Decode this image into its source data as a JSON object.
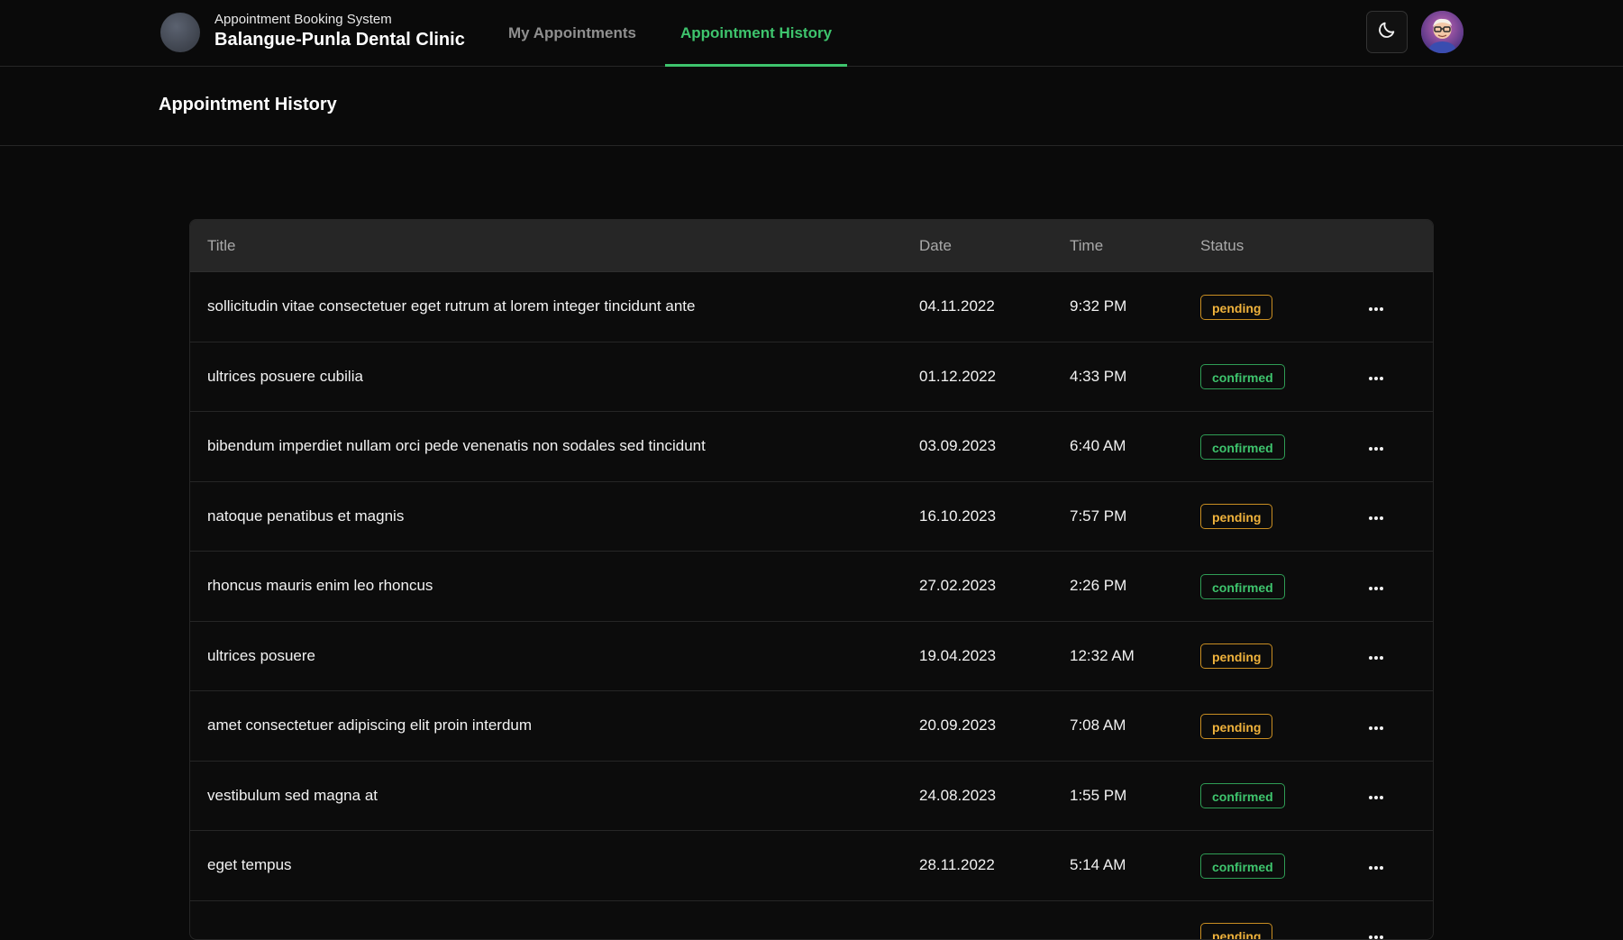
{
  "header": {
    "subtitle": "Appointment Booking System",
    "clinic_name": "Balangue-Punla Dental Clinic",
    "tabs": [
      {
        "label": "My Appointments",
        "active": false
      },
      {
        "label": "Appointment History",
        "active": true
      }
    ],
    "theme_icon": "moon-icon",
    "accent_color": "#3ec46d"
  },
  "page": {
    "title": "Appointment History"
  },
  "table": {
    "columns": [
      "Title",
      "Date",
      "Time",
      "Status"
    ],
    "rows": [
      {
        "title": "sollicitudin vitae consectetuer eget rutrum at lorem integer tincidunt ante",
        "date": "04.11.2022",
        "time": "9:32 PM",
        "status": "pending"
      },
      {
        "title": "ultrices posuere cubilia",
        "date": "01.12.2022",
        "time": "4:33 PM",
        "status": "confirmed"
      },
      {
        "title": "bibendum imperdiet nullam orci pede venenatis non sodales sed tincidunt",
        "date": "03.09.2023",
        "time": "6:40 AM",
        "status": "confirmed"
      },
      {
        "title": "natoque penatibus et magnis",
        "date": "16.10.2023",
        "time": "7:57 PM",
        "status": "pending"
      },
      {
        "title": "rhoncus mauris enim leo rhoncus",
        "date": "27.02.2023",
        "time": "2:26 PM",
        "status": "confirmed"
      },
      {
        "title": "ultrices posuere",
        "date": "19.04.2023",
        "time": "12:32 AM",
        "status": "pending"
      },
      {
        "title": "amet consectetuer adipiscing elit proin interdum",
        "date": "20.09.2023",
        "time": "7:08 AM",
        "status": "pending"
      },
      {
        "title": "vestibulum sed magna at",
        "date": "24.08.2023",
        "time": "1:55 PM",
        "status": "confirmed"
      },
      {
        "title": "eget tempus",
        "date": "28.11.2022",
        "time": "5:14 AM",
        "status": "confirmed"
      },
      {
        "title": "",
        "date": "",
        "time": "",
        "status": "pending"
      }
    ],
    "status_colors": {
      "pending": "#f0b33c",
      "confirmed": "#3ec46d"
    }
  }
}
